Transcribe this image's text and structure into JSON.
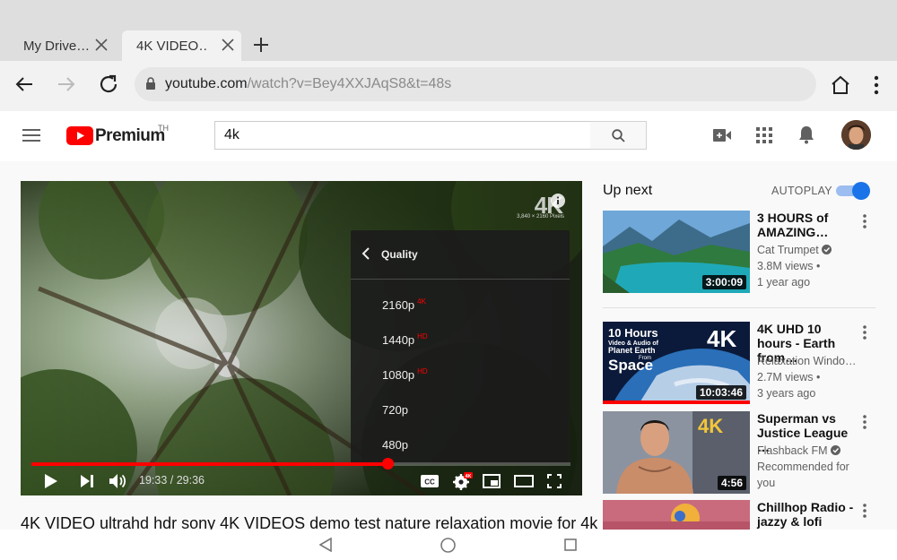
{
  "browser": {
    "tabs": [
      {
        "title": "My Drive…"
      },
      {
        "title": "4K VIDEO…"
      }
    ],
    "url_host": "youtube.com",
    "url_path": "/watch?v=Bey4XXJAqS8&t=48s"
  },
  "youtube": {
    "logo_text": "Premium",
    "region": "TH",
    "search_value": "4k"
  },
  "player": {
    "badge": "4K",
    "badge_sub": "3,840 × 2160 Pixels",
    "quality_menu": {
      "title": "Quality",
      "options": [
        {
          "label": "2160p",
          "tag": "4K"
        },
        {
          "label": "1440p",
          "tag": "HD"
        },
        {
          "label": "1080p",
          "tag": "HD"
        },
        {
          "label": "720p",
          "tag": ""
        },
        {
          "label": "480p",
          "tag": ""
        }
      ]
    },
    "time_display": "19:33 / 29:36",
    "progress_fraction": 0.66
  },
  "video_title": "4K VIDEO ultrahd hdr sony 4K VIDEOS demo test nature relaxation movie for 4k",
  "sidebar": {
    "up_next": "Up next",
    "autoplay_label": "AUTOPLAY",
    "autoplay_on": true,
    "videos": [
      {
        "title": "3 HOURS of AMAZING…",
        "channel": "Cat Trumpet",
        "verified": true,
        "meta1": "3.8M views •",
        "meta2": "1 year ago",
        "duration": "3:00:09"
      },
      {
        "title": "4K UHD 10 hours - Earth from…",
        "channel": "Relaxation Windo…",
        "verified": false,
        "meta1": "2.7M views •",
        "meta2": "3 years ago",
        "duration": "10:03:46",
        "thumb_text_1": "10 Hours",
        "thumb_text_2": "Video & Audio of",
        "thumb_text_3": "Planet Earth",
        "thumb_text_4": "From",
        "thumb_text_5": "Space",
        "thumb_badge": "4K"
      },
      {
        "title": "Superman vs Justice League …",
        "channel": "Flashback FM",
        "verified": true,
        "meta1": "Recommended for",
        "meta2": "you",
        "duration": "4:56",
        "thumb_badge": "4K"
      },
      {
        "title": "Chillhop Radio - jazzy & lofi hip…",
        "channel": "",
        "meta1": "",
        "meta2": "",
        "duration": ""
      }
    ]
  },
  "colors": {
    "accent_red": "#ff0000",
    "toggle_blue": "#1a73e8"
  }
}
